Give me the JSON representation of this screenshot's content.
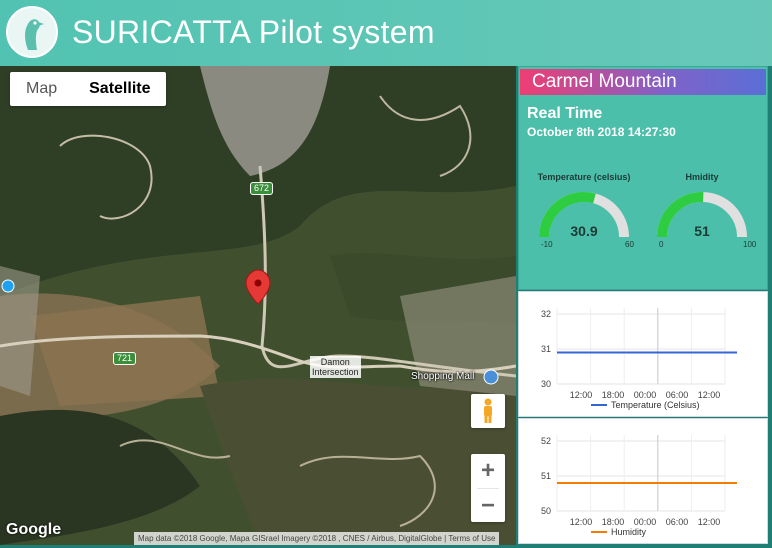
{
  "header": {
    "title": "SURICATTA Pilot system",
    "logo": "meerkat-logo-icon"
  },
  "map": {
    "type_buttons": [
      "Map",
      "Satellite"
    ],
    "active_type": "Satellite",
    "road_labels": [
      "672",
      "721"
    ],
    "place_label_line1": "Damon",
    "place_label_line2": "Intersection",
    "poi_label": "Shopping Mall",
    "zoom_in": "+",
    "zoom_out": "−",
    "logo": "Google",
    "attribution": "Map data ©2018 Google, Mapa GISrael Imagery ©2018 , CNES / Airbus, DigitalGlobe  |  Terms of Use"
  },
  "location": {
    "title": "Carmel Mountain"
  },
  "realtime": {
    "heading": "Real Time",
    "timestamp": "October 8th 2018 14:27:30",
    "gauges": [
      {
        "label": "Temperature (celsius)",
        "value": "30.9",
        "min": "-10",
        "max": "60",
        "color": "#2ecc40"
      },
      {
        "label": "Hmidity",
        "value": "51",
        "min": "0",
        "max": "100",
        "color": "#2ecc40"
      }
    ]
  },
  "chart_data": [
    {
      "type": "line",
      "x": [
        "12:00",
        "18:00",
        "00:00",
        "06:00",
        "12:00"
      ],
      "yticks": [
        "32",
        "31",
        "30"
      ],
      "ylim": [
        30,
        32
      ],
      "series": [
        {
          "name": "Temperature (Celsius)",
          "values": [
            30.9,
            30.9,
            30.9,
            30.9,
            30.9
          ],
          "color": "#3367d6"
        }
      ],
      "legend": "bottom"
    },
    {
      "type": "line",
      "x": [
        "12:00",
        "18:00",
        "00:00",
        "06:00",
        "12:00"
      ],
      "yticks": [
        "52",
        "51",
        "50"
      ],
      "ylim": [
        50,
        52
      ],
      "series": [
        {
          "name": "Humidity",
          "values": [
            50.8,
            50.8,
            50.8,
            50.8,
            50.8
          ],
          "color": "#f57c00"
        }
      ],
      "legend": "bottom"
    }
  ]
}
